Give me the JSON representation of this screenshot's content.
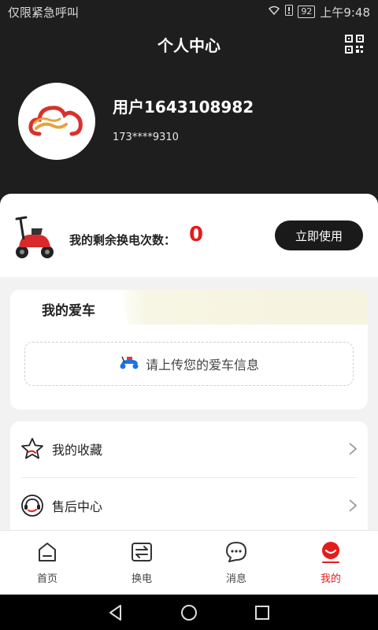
{
  "statusbar": {
    "left_text": "仅限紧急呼叫",
    "battery": "92",
    "time": "上午9:48"
  },
  "header": {
    "title": "个人中心",
    "username": "用户1643108982",
    "phone": "173****9310"
  },
  "swap": {
    "label": "我的剩余换电次数：",
    "count": "0",
    "button": "立即使用"
  },
  "car": {
    "tab_label": "我的爱车",
    "upload_text": "请上传您的爱车信息"
  },
  "menu": {
    "items": [
      {
        "label": "我的收藏",
        "icon": "star-icon"
      },
      {
        "label": "售后中心",
        "icon": "service-icon"
      }
    ]
  },
  "tabbar": {
    "items": [
      {
        "label": "首页",
        "icon": "home-icon"
      },
      {
        "label": "换电",
        "icon": "swap-icon"
      },
      {
        "label": "消息",
        "icon": "message-icon"
      },
      {
        "label": "我的",
        "icon": "profile-icon"
      }
    ],
    "active_color": "#e51c1c"
  },
  "colors": {
    "header_bg": "#1e1e1e",
    "accent_red": "#e51c1c"
  }
}
